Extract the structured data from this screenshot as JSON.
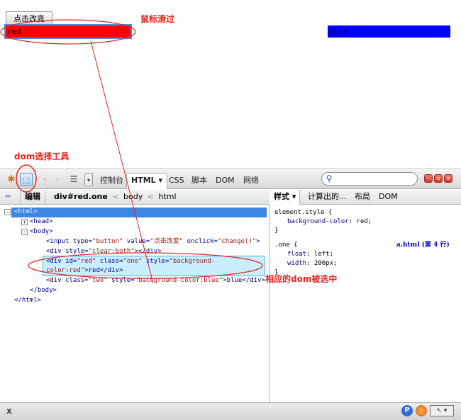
{
  "preview": {
    "button_label": "点击改变",
    "red_box_text": "red",
    "blue_box_text": "blue"
  },
  "annotations": {
    "hover": "鼠标滑过",
    "dom_tool": "dom选择工具",
    "selected": "相应的dom被选中",
    "color": "#e8241b"
  },
  "toolbar": {
    "prev_icon": "‹",
    "next_icon": "›",
    "menu_drop_icon": "▾",
    "tabs": {
      "console": "控制台",
      "html": "HTML ▾",
      "css": "CSS",
      "script": "脚本",
      "dom": "DOM",
      "net": "网络"
    },
    "search_placeholder": ""
  },
  "breadcrumbs": {
    "edit": "编辑",
    "current": "div#red.one",
    "sep": "<",
    "body": "body",
    "html": "html"
  },
  "tree": {
    "html_open": "<html>",
    "head": "<head>",
    "body_open": "<body>",
    "input_line": {
      "pre": "<input type=",
      "type_val": "\"button\"",
      "value_name": " value=",
      "value_val": "\"点击改变\"",
      "onclick_name": " onclick=",
      "onclick_val": "\"change()\"",
      "close": ">"
    },
    "div_clear": {
      "pre": "<div style=",
      "style_val": "\"clear:both\"",
      "close": "></div>"
    },
    "div_red_1": {
      "pre": "<div id=",
      "id_val": "\"red\"",
      "class_name": " class=",
      "class_val": "\"one\"",
      "style_name": " style=",
      "style_val": "\"background-"
    },
    "div_red_2": {
      "style_val": "color:red\"",
      "rest": ">red</div>"
    },
    "div_blue": {
      "pre": "<div class=",
      "class_val": "\"two\"",
      "style_name": " style=",
      "style_val": "\"background-color:blue\"",
      "rest": ">blue</div>"
    },
    "body_close": "</body>",
    "html_close": "</html>"
  },
  "style_tabs": {
    "style": "样式 ▾",
    "computed": "计算出的...",
    "layout": "布局",
    "dom": "DOM"
  },
  "css": {
    "element_style": "element.style {",
    "bg_prop": "background-color",
    "bg_val": ": red;",
    "close1": "}",
    "one_sel": ".one {",
    "float_prop": "float",
    "float_val": ": left;",
    "width_prop": "width",
    "width_val": ": 200px;",
    "close2": "}",
    "file_ref": "a.html (第 4 行)"
  },
  "statusbar": {
    "close": "x",
    "p_badge": "P"
  }
}
